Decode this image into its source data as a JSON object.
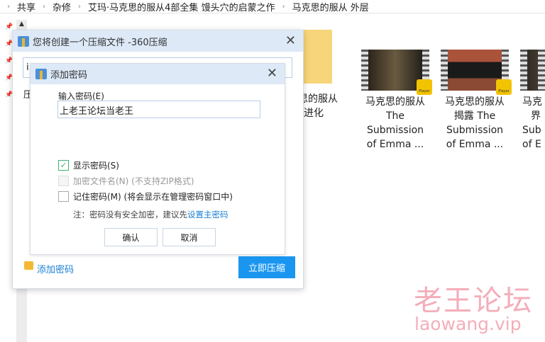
{
  "breadcrumb": [
    "共享",
    "杂修",
    "艾玛·马克思的服从4部全集 馒头穴的启蒙之作",
    "马克思的服从 外层"
  ],
  "outer_dialog": {
    "title": "您将创建一个压缩文件 -360压缩",
    "path_value": "i",
    "label_partial": "压",
    "add_password_link": "添加密码",
    "compress_button": "立即压缩"
  },
  "password_dialog": {
    "title": "添加密码",
    "input_label": "输入密码(E)",
    "password_value": "上老王论坛当老王",
    "options": [
      {
        "label": "显示密码(S)",
        "checked": true,
        "disabled": false
      },
      {
        "label": "加密文件名(N) (不支持ZIP格式)",
        "checked": false,
        "disabled": true
      },
      {
        "label": "记住密码(M) (将会显示在管理密码窗口中)",
        "checked": false,
        "disabled": false
      }
    ],
    "note": "注：密码没有安全加密，建议先",
    "note_link": "设置主密码",
    "ok": "确认",
    "cancel": "取消"
  },
  "files": [
    {
      "lines": [
        "思的服从",
        "进化"
      ],
      "type": "folder"
    },
    {
      "lines": [
        "马克思的服从",
        "The",
        "Submission",
        "of Emma ..."
      ],
      "type": "video",
      "badge": "Player"
    },
    {
      "lines": [
        "马克思的服从",
        "揭露 The",
        "Submission",
        "of Emma ..."
      ],
      "type": "video",
      "badge": "Player"
    },
    {
      "lines": [
        "马克",
        "界",
        "Sub",
        "of E"
      ],
      "type": "video"
    }
  ],
  "watermark": {
    "cn": "老王论坛",
    "url": "laowang.vip"
  },
  "colors": {
    "accent": "#1a96f0",
    "title_bar": "#dde9f7"
  }
}
